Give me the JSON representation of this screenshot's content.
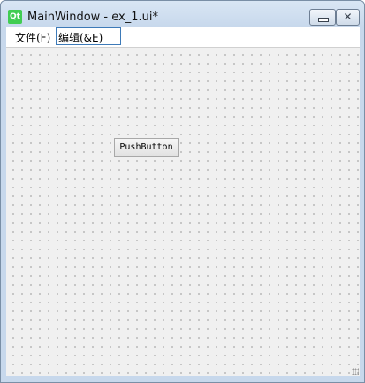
{
  "window": {
    "app_icon": "qt-logo-icon",
    "app_icon_text": "Qt",
    "title": "MainWindow - ex_1.ui*",
    "controls": [
      "minimize-icon",
      "close-icon"
    ],
    "close_glyph": "✕"
  },
  "menubar": {
    "file_label": "文件(F)",
    "edit_value": "编辑(&E)"
  },
  "form": {
    "push_button_label": "PushButton"
  }
}
